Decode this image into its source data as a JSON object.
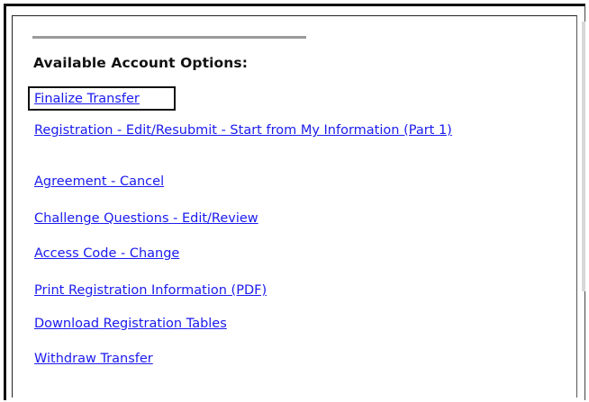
{
  "account_options": {
    "heading": "Available Account Options:",
    "links": [
      {
        "label": "Finalize Transfer",
        "focused": true
      },
      {
        "label": "Registration - Edit/Resubmit - Start from My Information (Part 1)",
        "focused": false
      },
      {
        "label": "Agreement - Cancel",
        "focused": false
      },
      {
        "label": "Challenge Questions - Edit/Review",
        "focused": false
      },
      {
        "label": "Access Code - Change",
        "focused": false
      },
      {
        "label": "Print Registration Information (PDF)",
        "focused": false
      },
      {
        "label": "Download Registration Tables",
        "focused": false
      },
      {
        "label": "Withdraw Transfer",
        "focused": false
      }
    ]
  },
  "colors": {
    "link": "#1a1aee",
    "heading": "#111111",
    "separator": "#9a9a9a",
    "focus_border": "#111111"
  }
}
